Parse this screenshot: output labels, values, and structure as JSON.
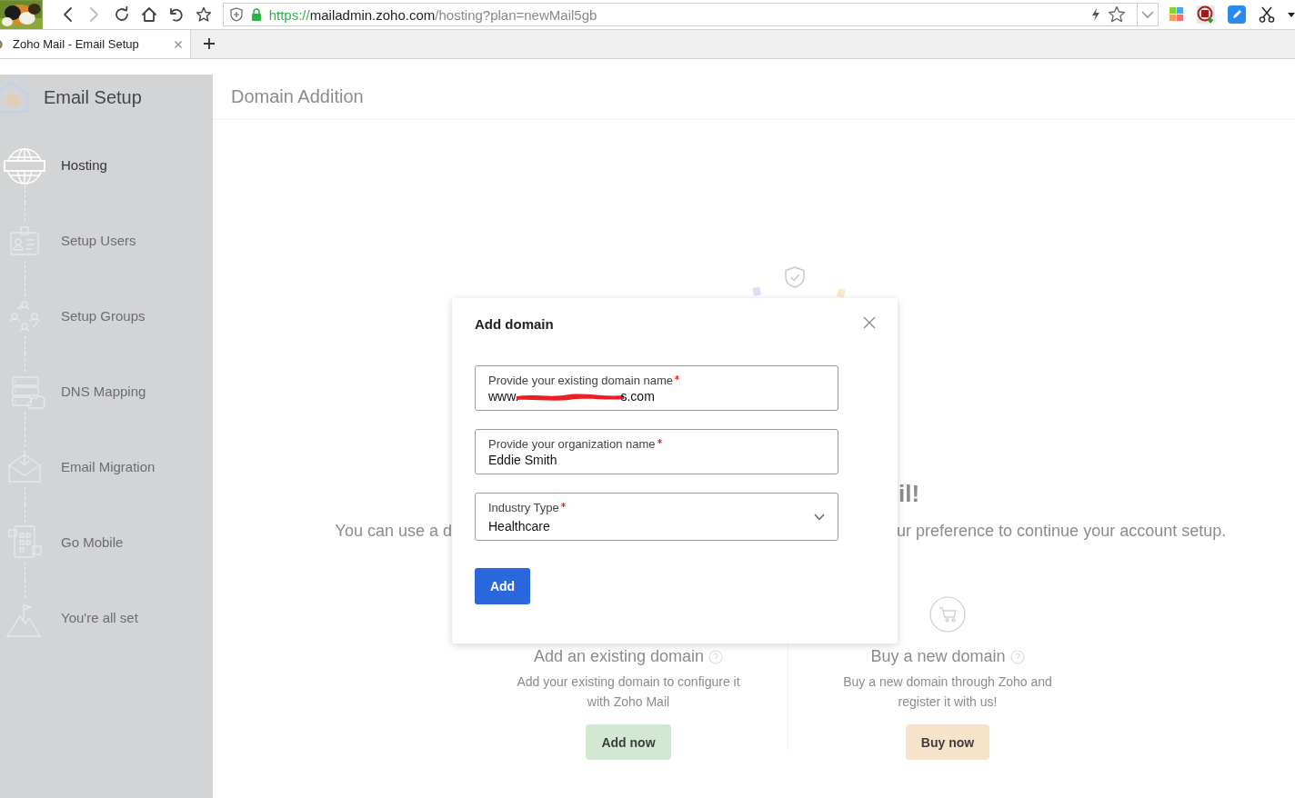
{
  "browser": {
    "back_disabled": false,
    "forward_disabled": true,
    "url": {
      "scheme": "https://",
      "host": "mailadmin.zoho.com",
      "path": "/hosting?plan=newMail5gb"
    }
  },
  "tabs": [
    {
      "title": "Zoho Mail - Email Setup",
      "selected": true
    }
  ],
  "sidebar": {
    "title": "Email Setup",
    "steps": [
      {
        "label": "Hosting",
        "selected": true
      },
      {
        "label": "Setup Users",
        "selected": false
      },
      {
        "label": "Setup Groups",
        "selected": false
      },
      {
        "label": "DNS Mapping",
        "selected": false
      },
      {
        "label": "Email Migration",
        "selected": false
      },
      {
        "label": "Go Mobile",
        "selected": false
      },
      {
        "label": "You're all set",
        "selected": false
      }
    ]
  },
  "page": {
    "title": "Domain Addition"
  },
  "background": {
    "heading": "il!",
    "tagline_start": "You can use a d",
    "tagline_end": "ur preference to continue your account setup.",
    "options": [
      {
        "title": "Add an existing domain",
        "description": "Add your existing domain to configure it with Zoho Mail",
        "button": "Add now",
        "color": "#d3e8d3"
      },
      {
        "title": "Buy a new domain",
        "description": "Buy a new domain through Zoho and register it with us!",
        "button": "Buy now",
        "color": "#f6e3c9"
      }
    ]
  },
  "dialog": {
    "title": "Add domain",
    "fields": [
      {
        "kind": "text",
        "label": "Provide your existing domain name",
        "required": true,
        "value": "www.",
        "redacted": true,
        "value_end": "s.com"
      },
      {
        "kind": "text",
        "label": "Provide your organization name",
        "required": true,
        "value": "Eddie Smith"
      },
      {
        "kind": "select",
        "label": "Industry Type",
        "required": true,
        "value": "Healthcare"
      }
    ],
    "button": "Add"
  }
}
